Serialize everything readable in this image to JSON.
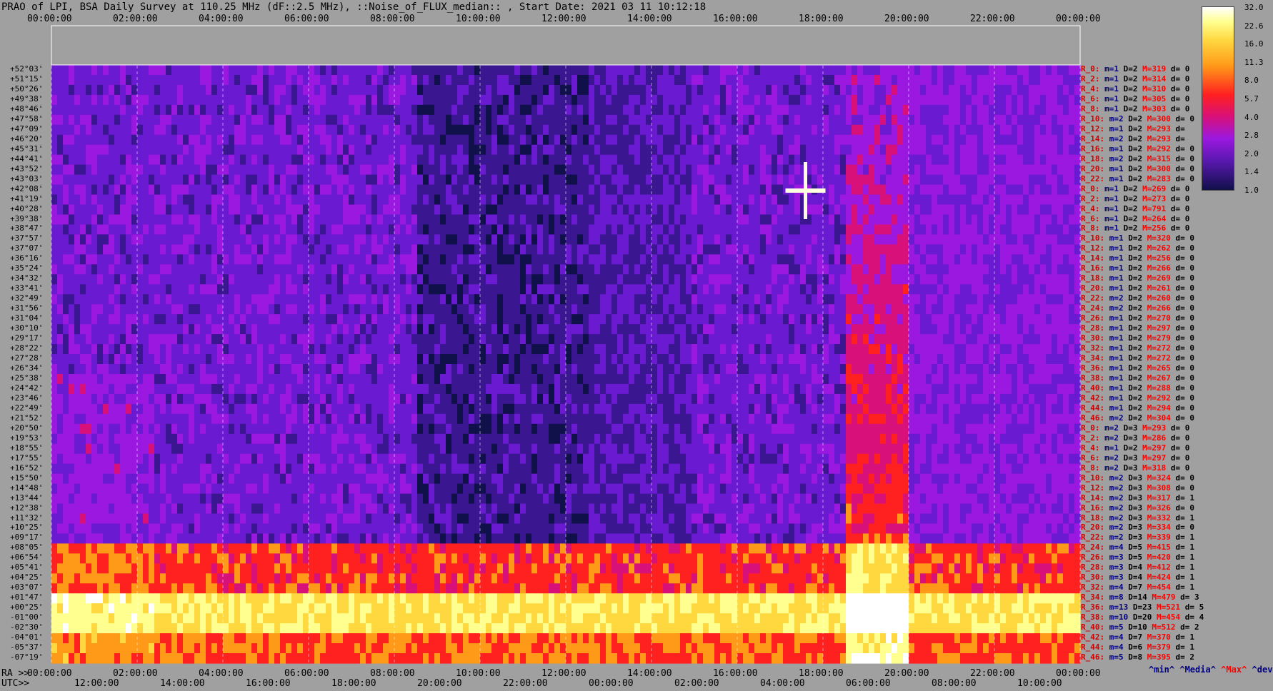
{
  "title": "PRAO of LPI, BSA Daily Survey at 110.25 MHz (dF::2.5 MHz), ::Noise_of_FLUX_median:: , Start Date: 2021 03 11 10:12:18",
  "top_axis": [
    "00:00:00",
    "02:00:00",
    "04:00:00",
    "06:00:00",
    "08:00:00",
    "10:00:00",
    "12:00:00",
    "14:00:00",
    "16:00:00",
    "18:00:00",
    "20:00:00",
    "22:00:00",
    "00:00:00"
  ],
  "ra_label": "RA >>",
  "ra_axis": [
    "00:00:00",
    "02:00:00",
    "04:00:00",
    "06:00:00",
    "08:00:00",
    "10:00:00",
    "12:00:00",
    "14:00:00",
    "16:00:00",
    "18:00:00",
    "20:00:00",
    "22:00:00",
    "00:00:00"
  ],
  "utc_label": "UTC>>",
  "utc_axis": [
    "12:00:00",
    "14:00:00",
    "16:00:00",
    "18:00:00",
    "20:00:00",
    "22:00:00",
    "00:00:00",
    "02:00:00",
    "04:00:00",
    "06:00:00",
    "08:00:00",
    "10:00:00"
  ],
  "colorbar": {
    "ticks": [
      "32.0",
      "22.6",
      "16.0",
      "11.3",
      "8.0",
      "5.7",
      "4.0",
      "2.8",
      "2.0",
      "1.4",
      "1.0"
    ]
  },
  "legend": {
    "min": "^min^",
    "median": "^Media^",
    "max": "^Max^",
    "devia": "^devia^"
  },
  "declinations": [
    "+52°03'",
    "+51°15'",
    "+50°26'",
    "+49°38'",
    "+48°46'",
    "+47°58'",
    "+47°09'",
    "+46°20'",
    "+45°31'",
    "+44°41'",
    "+43°52'",
    "+43°03'",
    "+42°08'",
    "+41°19'",
    "+40°28'",
    "+39°38'",
    "+38°47'",
    "+37°57'",
    "+37°07'",
    "+36°16'",
    "+35°24'",
    "+34°32'",
    "+33°41'",
    "+32°49'",
    "+31°56'",
    "+31°04'",
    "+30°10'",
    "+29°17'",
    "+28°22'",
    "+27°28'",
    "+26°34'",
    "+25°38'",
    "+24°42'",
    "+23°46'",
    "+22°49'",
    "+21°52'",
    "+20°50'",
    "+19°53'",
    "+18°55'",
    "+17°55'",
    "+16°52'",
    "+15°50'",
    "+14°48'",
    "+13°44'",
    "+12°38'",
    "+11°32'",
    "+10°25'",
    "+09°17'",
    "+08°05'",
    "+06°54'",
    "+05°41'",
    "+04°25'",
    "+03°07'",
    "+01°47'",
    "+00°25'",
    "-01°00'",
    "-02°30'",
    "-04°01'",
    "-05°37'",
    "-07°19'"
  ],
  "stats": [
    {
      "r": "R_0:",
      "m": "m=1",
      "d": "D=2",
      "mx": "M=319",
      "dv": "d= 0"
    },
    {
      "r": "R_2:",
      "m": "m=1",
      "d": "D=2",
      "mx": "M=314",
      "dv": "d= 0"
    },
    {
      "r": "R_4:",
      "m": "m=1",
      "d": "D=2",
      "mx": "M=310",
      "dv": "d= 0"
    },
    {
      "r": "R_6:",
      "m": "m=1",
      "d": "D=2",
      "mx": "M=305",
      "dv": "d= 0"
    },
    {
      "r": "R_8:",
      "m": "m=1",
      "d": "D=2",
      "mx": "M=303",
      "dv": "d= 0"
    },
    {
      "r": "R_10:",
      "m": "m=2",
      "d": "D=2",
      "mx": "M=300",
      "dv": "d= 0"
    },
    {
      "r": "R_12:",
      "m": "m=1",
      "d": "D=2",
      "mx": "M=293",
      "dv": "d="
    },
    {
      "r": "R_14:",
      "m": "m=2",
      "d": "D=2",
      "mx": "M=293",
      "dv": "d="
    },
    {
      "r": "R_16:",
      "m": "m=1",
      "d": "D=2",
      "mx": "M=292",
      "dv": "d= 0"
    },
    {
      "r": "R_18:",
      "m": "m=2",
      "d": "D=2",
      "mx": "M=315",
      "dv": "d= 0"
    },
    {
      "r": "R_20:",
      "m": "m=1",
      "d": "D=2",
      "mx": "M=300",
      "dv": "d= 0"
    },
    {
      "r": "R_22:",
      "m": "m=1",
      "d": "D=2",
      "mx": "M=283",
      "dv": "d= 0"
    },
    {
      "r": "R_0:",
      "m": "m=1",
      "d": "D=2",
      "mx": "M=269",
      "dv": "d= 0"
    },
    {
      "r": "R_2:",
      "m": "m=1",
      "d": "D=2",
      "mx": "M=273",
      "dv": "d= 0"
    },
    {
      "r": "R_4:",
      "m": "m=1",
      "d": "D=2",
      "mx": "M=791",
      "dv": "d= 0"
    },
    {
      "r": "R_6:",
      "m": "m=1",
      "d": "D=2",
      "mx": "M=264",
      "dv": "d= 0"
    },
    {
      "r": "R_8:",
      "m": "m=1",
      "d": "D=2",
      "mx": "M=256",
      "dv": "d= 0"
    },
    {
      "r": "R_10:",
      "m": "m=1",
      "d": "D=2",
      "mx": "M=320",
      "dv": "d= 0"
    },
    {
      "r": "R_12:",
      "m": "m=1",
      "d": "D=2",
      "mx": "M=262",
      "dv": "d= 0"
    },
    {
      "r": "R_14:",
      "m": "m=1",
      "d": "D=2",
      "mx": "M=256",
      "dv": "d= 0"
    },
    {
      "r": "R_16:",
      "m": "m=1",
      "d": "D=2",
      "mx": "M=266",
      "dv": "d= 0"
    },
    {
      "r": "R_18:",
      "m": "m=1",
      "d": "D=2",
      "mx": "M=269",
      "dv": "d= 0"
    },
    {
      "r": "R_20:",
      "m": "m=1",
      "d": "D=2",
      "mx": "M=261",
      "dv": "d= 0"
    },
    {
      "r": "R_22:",
      "m": "m=2",
      "d": "D=2",
      "mx": "M=260",
      "dv": "d= 0"
    },
    {
      "r": "R_24:",
      "m": "m=2",
      "d": "D=2",
      "mx": "M=266",
      "dv": "d= 0"
    },
    {
      "r": "R_26:",
      "m": "m=1",
      "d": "D=2",
      "mx": "M=270",
      "dv": "d= 0"
    },
    {
      "r": "R_28:",
      "m": "m=1",
      "d": "D=2",
      "mx": "M=297",
      "dv": "d= 0"
    },
    {
      "r": "R_30:",
      "m": "m=1",
      "d": "D=2",
      "mx": "M=279",
      "dv": "d= 0"
    },
    {
      "r": "R_32:",
      "m": "m=1",
      "d": "D=2",
      "mx": "M=272",
      "dv": "d= 0"
    },
    {
      "r": "R_34:",
      "m": "m=1",
      "d": "D=2",
      "mx": "M=272",
      "dv": "d= 0"
    },
    {
      "r": "R_36:",
      "m": "m=1",
      "d": "D=2",
      "mx": "M=265",
      "dv": "d= 0"
    },
    {
      "r": "R_38:",
      "m": "m=1",
      "d": "D=2",
      "mx": "M=267",
      "dv": "d= 0"
    },
    {
      "r": "R_40:",
      "m": "m=1",
      "d": "D=2",
      "mx": "M=288",
      "dv": "d= 0"
    },
    {
      "r": "R_42:",
      "m": "m=1",
      "d": "D=2",
      "mx": "M=292",
      "dv": "d= 0"
    },
    {
      "r": "R_44:",
      "m": "m=1",
      "d": "D=2",
      "mx": "M=294",
      "dv": "d= 0"
    },
    {
      "r": "R_46:",
      "m": "m=2",
      "d": "D=2",
      "mx": "M=304",
      "dv": "d= 0"
    },
    {
      "r": "R_0:",
      "m": "m=2",
      "d": "D=3",
      "mx": "M=293",
      "dv": "d= 0"
    },
    {
      "r": "R_2:",
      "m": "m=2",
      "d": "D=3",
      "mx": "M=286",
      "dv": "d= 0"
    },
    {
      "r": "R_4:",
      "m": "m=1",
      "d": "D=2",
      "mx": "M=297",
      "dv": "d= 0"
    },
    {
      "r": "R_6:",
      "m": "m=2",
      "d": "D=3",
      "mx": "M=297",
      "dv": "d= 0"
    },
    {
      "r": "R_8:",
      "m": "m=2",
      "d": "D=3",
      "mx": "M=318",
      "dv": "d= 0"
    },
    {
      "r": "R_10:",
      "m": "m=2",
      "d": "D=3",
      "mx": "M=324",
      "dv": "d= 0"
    },
    {
      "r": "R_12:",
      "m": "m=2",
      "d": "D=3",
      "mx": "M=308",
      "dv": "d= 0"
    },
    {
      "r": "R_14:",
      "m": "m=2",
      "d": "D=3",
      "mx": "M=317",
      "dv": "d= 1"
    },
    {
      "r": "R_16:",
      "m": "m=2",
      "d": "D=3",
      "mx": "M=326",
      "dv": "d= 0"
    },
    {
      "r": "R_18:",
      "m": "m=2",
      "d": "D=3",
      "mx": "M=332",
      "dv": "d= 1"
    },
    {
      "r": "R_20:",
      "m": "m=2",
      "d": "D=3",
      "mx": "M=334",
      "dv": "d= 0"
    },
    {
      "r": "R_22:",
      "m": "m=2",
      "d": "D=3",
      "mx": "M=339",
      "dv": "d= 1"
    },
    {
      "r": "R_24:",
      "m": "m=4",
      "d": "D=5",
      "mx": "M=415",
      "dv": "d= 1"
    },
    {
      "r": "R_26:",
      "m": "m=3",
      "d": "D=5",
      "mx": "M=420",
      "dv": "d= 1"
    },
    {
      "r": "R_28:",
      "m": "m=3",
      "d": "D=4",
      "mx": "M=412",
      "dv": "d= 1"
    },
    {
      "r": "R_30:",
      "m": "m=3",
      "d": "D=4",
      "mx": "M=424",
      "dv": "d= 1"
    },
    {
      "r": "R_32:",
      "m": "m=4",
      "d": "D=7",
      "mx": "M=454",
      "dv": "d= 1"
    },
    {
      "r": "R_34:",
      "m": "m=8",
      "d": "D=14",
      "mx": "M=479",
      "dv": "d= 3"
    },
    {
      "r": "R_36:",
      "m": "m=13",
      "d": "D=23",
      "mx": "M=521",
      "dv": "d= 5"
    },
    {
      "r": "R_38:",
      "m": "m=10",
      "d": "D=20",
      "mx": "M=454",
      "dv": "d= 4"
    },
    {
      "r": "R_40:",
      "m": "m=5",
      "d": "D=10",
      "mx": "M=512",
      "dv": "d= 2"
    },
    {
      "r": "R_42:",
      "m": "m=4",
      "d": "D=7",
      "mx": "M=370",
      "dv": "d= 1"
    },
    {
      "r": "R_44:",
      "m": "m=4",
      "d": "D=6",
      "mx": "M=379",
      "dv": "d= 1"
    },
    {
      "r": "R_46:",
      "m": "m=5",
      "d": "D=8",
      "mx": "M=395",
      "dv": "d= 2"
    }
  ],
  "chart_data": {
    "type": "heatmap",
    "title": "PRAO of LPI, BSA Daily Survey at 110.25 MHz (dF::2.5 MHz), ::Noise_of_FLUX_median:: , Start Date: 2021 03 11 10:12:18",
    "x_ra_ticks": [
      "00:00:00",
      "02:00:00",
      "04:00:00",
      "06:00:00",
      "08:00:00",
      "10:00:00",
      "12:00:00",
      "14:00:00",
      "16:00:00",
      "18:00:00",
      "20:00:00",
      "22:00:00",
      "00:00:00"
    ],
    "x_utc_ticks": [
      "12:00:00",
      "14:00:00",
      "16:00:00",
      "18:00:00",
      "20:00:00",
      "22:00:00",
      "00:00:00",
      "02:00:00",
      "04:00:00",
      "06:00:00",
      "08:00:00",
      "10:00:00"
    ],
    "colorscale_range": [
      1.0,
      32.0
    ],
    "colorscale": "log",
    "row_count": 60,
    "colors": [
      "#10104a",
      "#3a1690",
      "#6a1ad0",
      "#9a18e0",
      "#d8107a",
      "#ff2020",
      "#ff9a18",
      "#ffd840",
      "#ffff90",
      "#ffffff"
    ]
  }
}
